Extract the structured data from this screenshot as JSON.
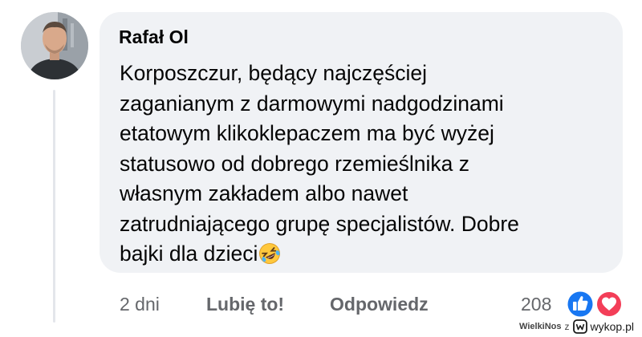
{
  "comment": {
    "author": "Rafał Ol",
    "lines": [
      "Korposzczur, będący najczęściej",
      "zaganianym z darmowymi nadgodzinami",
      "etatowym klikoklepaczem ma być wyżej",
      "statusowo od dobrego rzemieślnika z",
      "własnym zakładem albo nawet",
      "zatrudniającego grupę specjalistów. Dobre",
      "bajki dla dzieci"
    ],
    "emoji": "rolling-on-floor-laughing-emoji"
  },
  "actions": {
    "time": "2 dni",
    "like_label": "Lubię to!",
    "reply_label": "Odpowiedz",
    "reaction_count": "208",
    "reaction_icons": [
      "like-reaction-icon",
      "love-reaction-icon"
    ]
  },
  "watermark": {
    "user": "WielkiNos",
    "separator": "z",
    "brand": "wykop.pl"
  },
  "colors": {
    "bubble": "#f0f2f5",
    "secondary_text": "#65676b",
    "like_blue": "#1877f2",
    "love_red": "#f33e58"
  }
}
